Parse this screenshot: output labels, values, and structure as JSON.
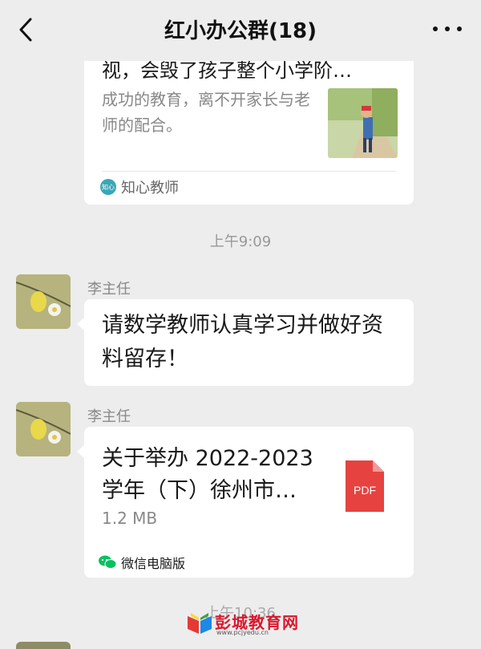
{
  "nav": {
    "title": "红小办公群(18)",
    "back_icon": "chevron-left-icon",
    "more_icon": "more-dots-icon"
  },
  "messages": [
    {
      "type": "article",
      "title_cut": "视，会毁了孩子整个小学阶…",
      "description": "成功的教育，离不开家长与老师的配合。",
      "source": "知心教师"
    },
    {
      "type": "time",
      "text": "上午9:09"
    },
    {
      "type": "text",
      "sender": "李主任",
      "text": "请数学教师认真学习并做好资料留存！"
    },
    {
      "type": "file",
      "sender": "李主任",
      "file_name": "关于举办 2022-2023 学年（下）徐州市…",
      "file_size": "1.2 MB",
      "file_type": "PDF",
      "source": "微信电脑版"
    },
    {
      "type": "time",
      "text": "上午10:36"
    }
  ],
  "watermark": {
    "name": "彭城教育网",
    "url": "www.pcjyedu.cn"
  },
  "colors": {
    "background": "#ededed",
    "bubble": "#ffffff",
    "pdf_red": "#e64340",
    "watermark_red": "#d9182d"
  }
}
